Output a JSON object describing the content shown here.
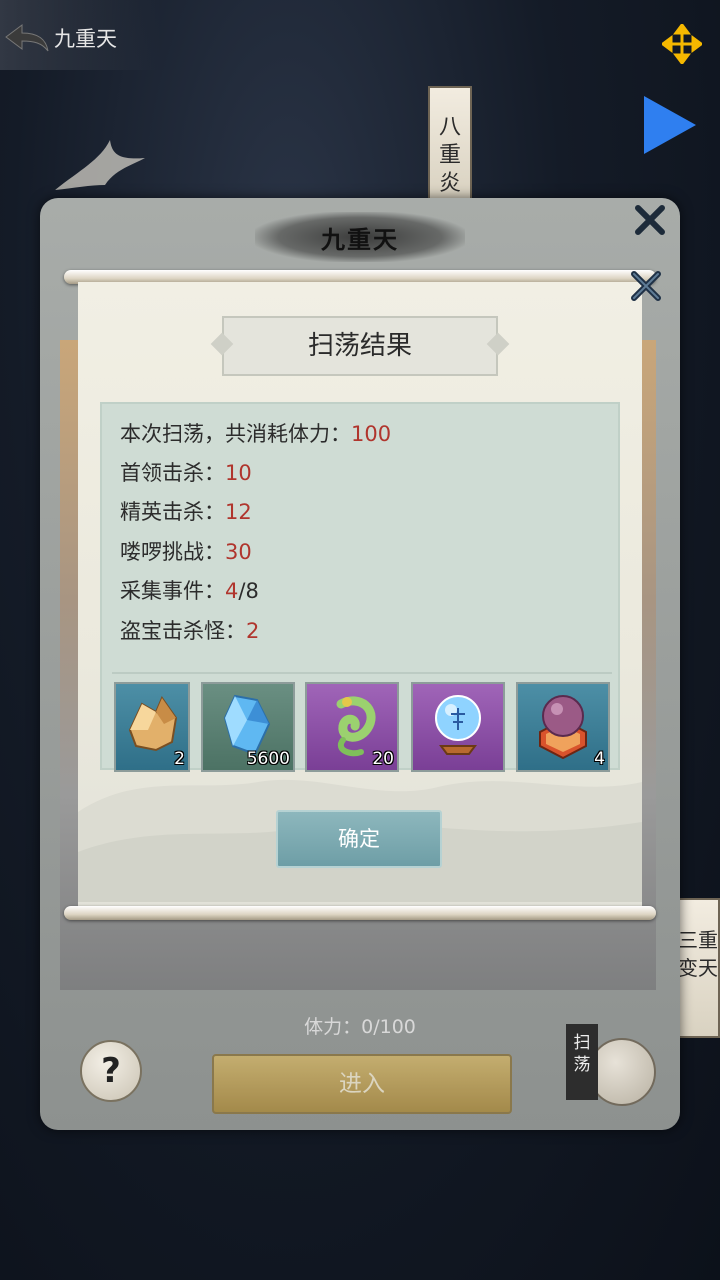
{
  "topbar": {
    "back_label": "九重天"
  },
  "side_tags": {
    "upper": "八重炎",
    "lower": "三重变天"
  },
  "outer_panel": {
    "title": "九重天",
    "stamina_text": "体力：0/100",
    "help_label": "?",
    "enter_label": "进入",
    "sweep_badge": "扫荡"
  },
  "dialog": {
    "title": "扫荡结果",
    "stats": [
      {
        "label": "本次扫荡，共消耗体力：",
        "value": "100",
        "suffix": ""
      },
      {
        "label": "首领击杀：",
        "value": "10",
        "suffix": ""
      },
      {
        "label": "精英击杀：",
        "value": "12",
        "suffix": ""
      },
      {
        "label": "喽啰挑战：",
        "value": "30",
        "suffix": ""
      },
      {
        "label": "采集事件：",
        "value": "4",
        "suffix": "/8"
      },
      {
        "label": "盗宝击杀怪：",
        "value": "2",
        "suffix": ""
      }
    ],
    "rewards": [
      {
        "icon": "gold-ore-icon",
        "count": "2",
        "frame": "blue"
      },
      {
        "icon": "blue-crystal-icon",
        "count": "5600",
        "frame": "green"
      },
      {
        "icon": "jade-pendant-icon",
        "count": "20",
        "frame": "purple"
      },
      {
        "icon": "crystal-orb-icon",
        "count": "",
        "frame": "purple"
      },
      {
        "icon": "purple-pearl-icon",
        "count": "4",
        "frame": "blue"
      }
    ],
    "confirm_label": "确定"
  },
  "colors": {
    "value_red": "#b0352d",
    "play_blue": "#2f7ff0",
    "move_yellow": "#f5b800"
  }
}
